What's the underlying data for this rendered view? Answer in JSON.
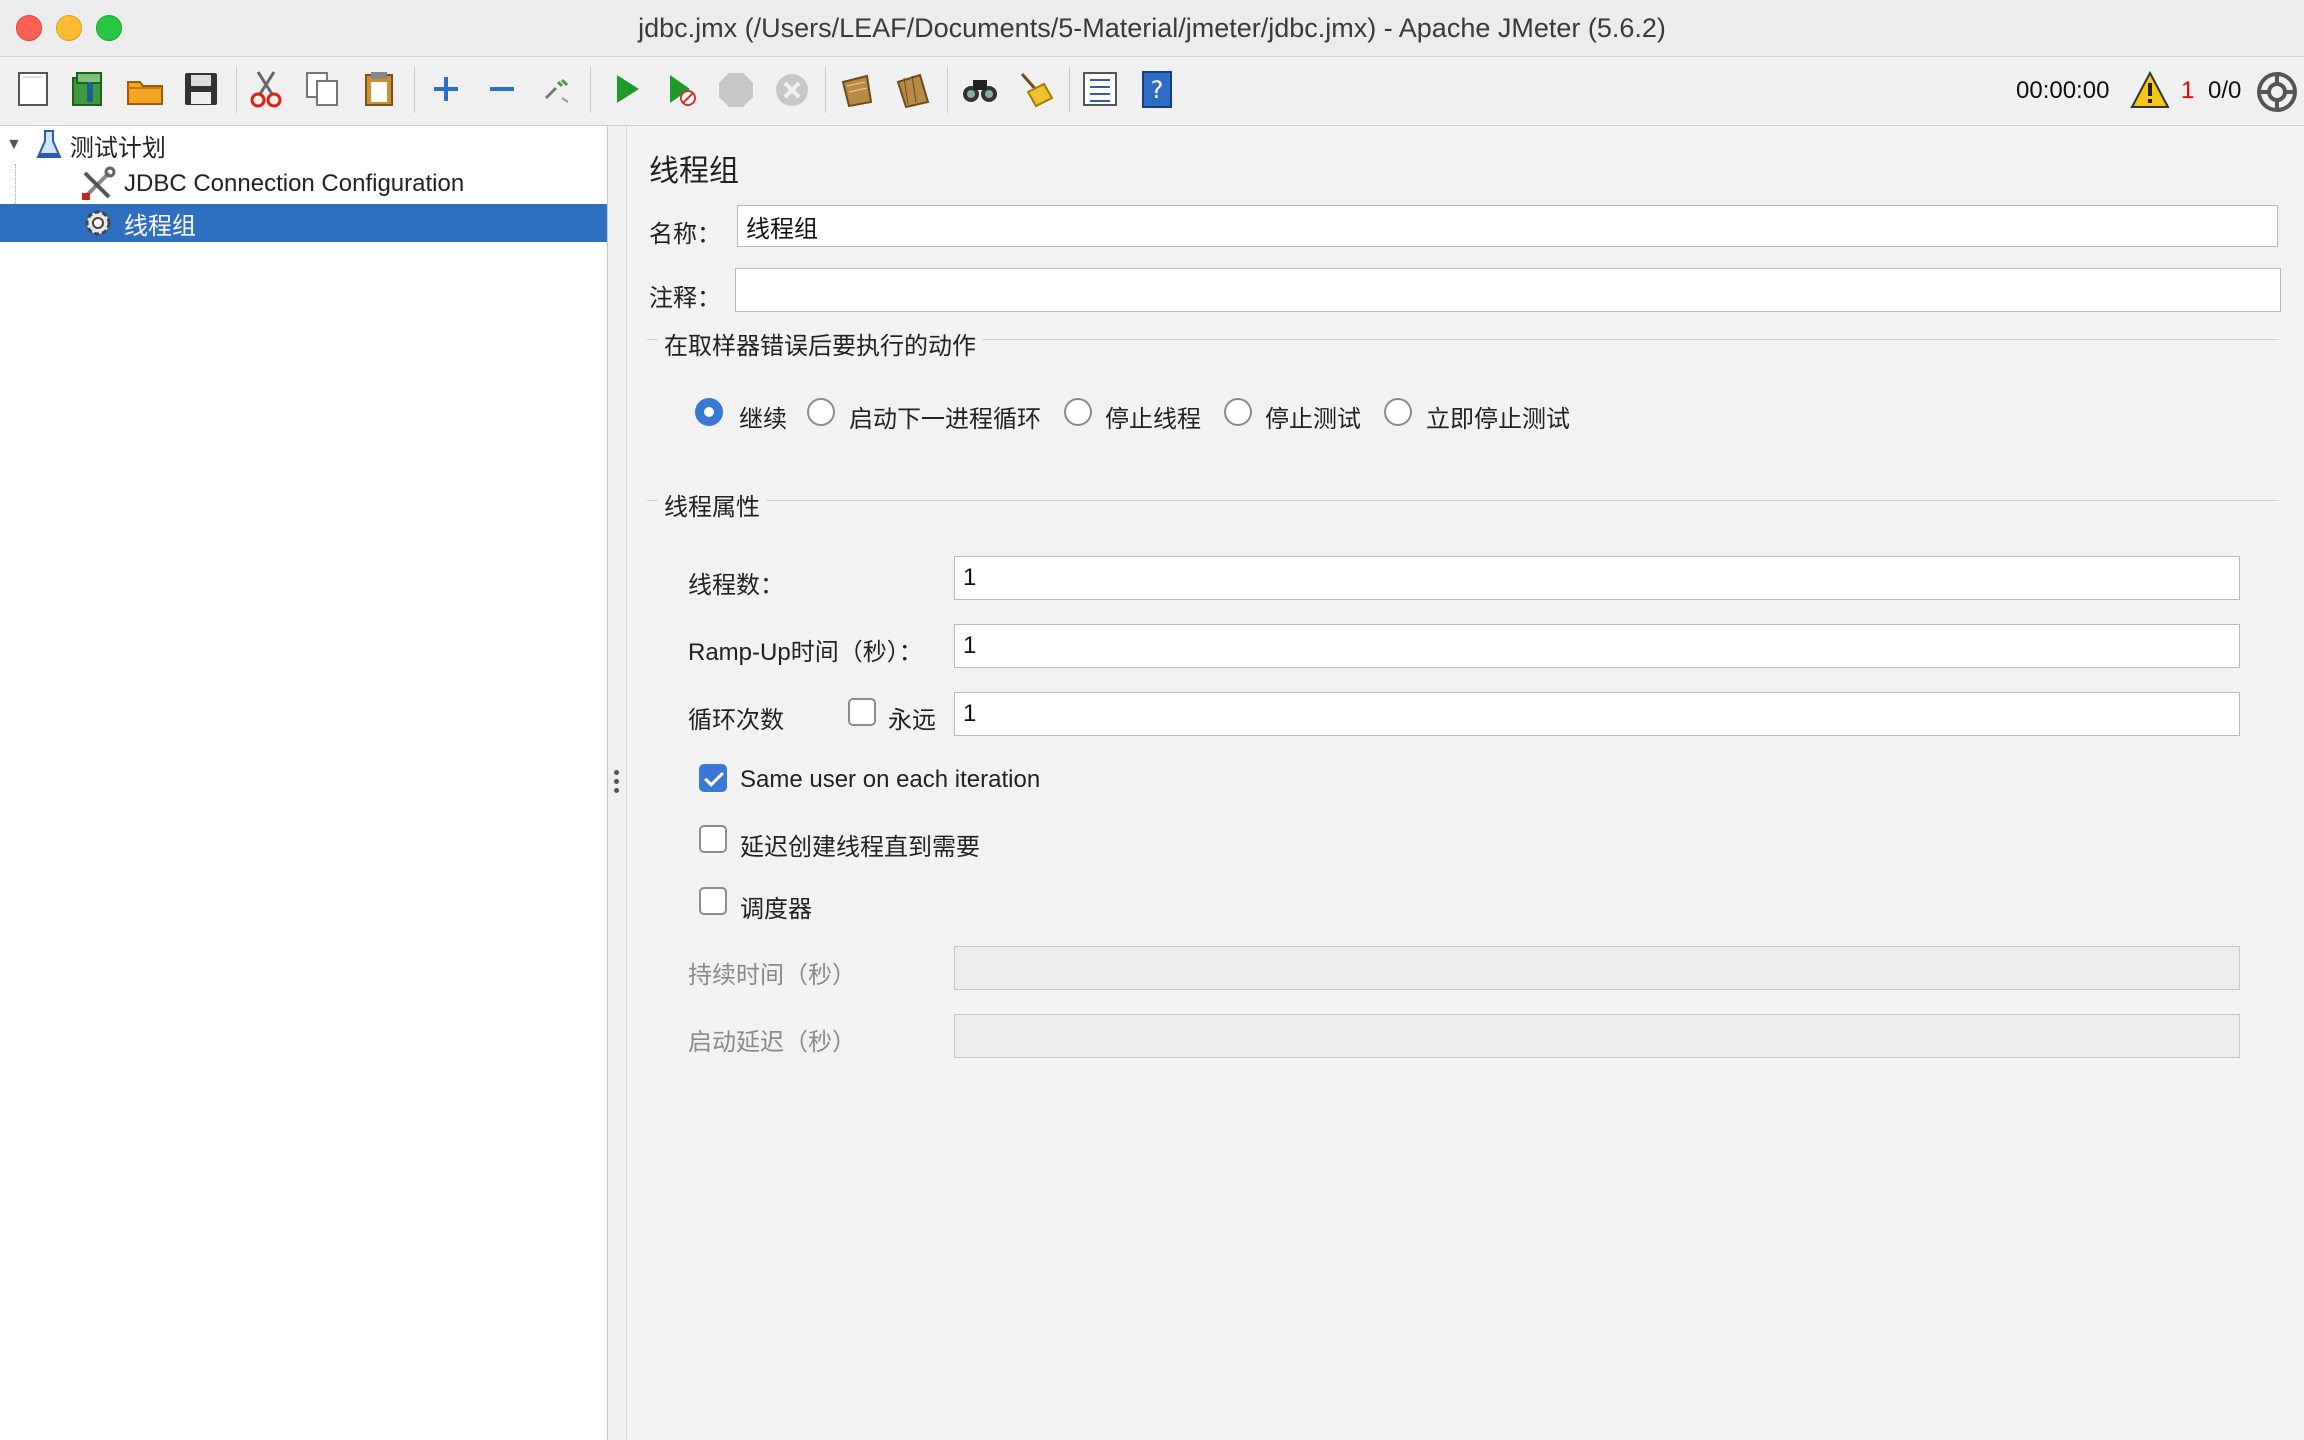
{
  "window": {
    "title": "jdbc.jmx (/Users/LEAF/Documents/5-Material/jmeter/jdbc.jmx) - Apache JMeter (5.6.2)"
  },
  "toolbar": {
    "icons": [
      "new-icon",
      "templates-icon",
      "open-icon",
      "save-icon",
      "cut-icon",
      "copy-icon",
      "paste-icon",
      "expand-icon",
      "collapse-icon",
      "toggle-icon",
      "start-icon",
      "start-no-pauses-icon",
      "stop-icon",
      "shutdown-icon",
      "clear-icon",
      "clear-all-icon",
      "search-icon",
      "reset-search-icon",
      "function-helper-icon",
      "help-icon"
    ],
    "elapsed_time": "00:00:00",
    "error_count": "1",
    "active_threads": "0/0"
  },
  "tree": {
    "items": [
      {
        "label": "测试计划",
        "icon": "test-plan-flask-icon"
      },
      {
        "label": "JDBC Connection Configuration",
        "icon": "config-tools-icon"
      },
      {
        "label": "线程组",
        "icon": "thread-group-gear-icon"
      }
    ]
  },
  "panel": {
    "title": "线程组",
    "name_label": "名称：",
    "name_value": "线程组",
    "comment_label": "注释：",
    "comment_value": "",
    "error_action_section": "在取样器错误后要执行的动作",
    "error_actions": [
      {
        "label": "继续",
        "checked": true
      },
      {
        "label": "启动下一进程循环",
        "checked": false
      },
      {
        "label": "停止线程",
        "checked": false
      },
      {
        "label": "停止测试",
        "checked": false
      },
      {
        "label": "立即停止测试",
        "checked": false
      }
    ],
    "thread_props_section": "线程属性",
    "threads_label": "线程数：",
    "threads_value": "1",
    "rampup_label": "Ramp-Up时间（秒）：",
    "rampup_value": "1",
    "loop_label": "循环次数",
    "forever_label": "永远",
    "forever_checked": false,
    "loop_value": "1",
    "same_user_label": "Same user on each iteration",
    "same_user_checked": true,
    "delay_create_label": "延迟创建线程直到需要",
    "delay_create_checked": false,
    "scheduler_label": "调度器",
    "scheduler_checked": false,
    "duration_label": "持续时间（秒）",
    "duration_value": "",
    "startup_delay_label": "启动延迟（秒）",
    "startup_delay_value": ""
  }
}
